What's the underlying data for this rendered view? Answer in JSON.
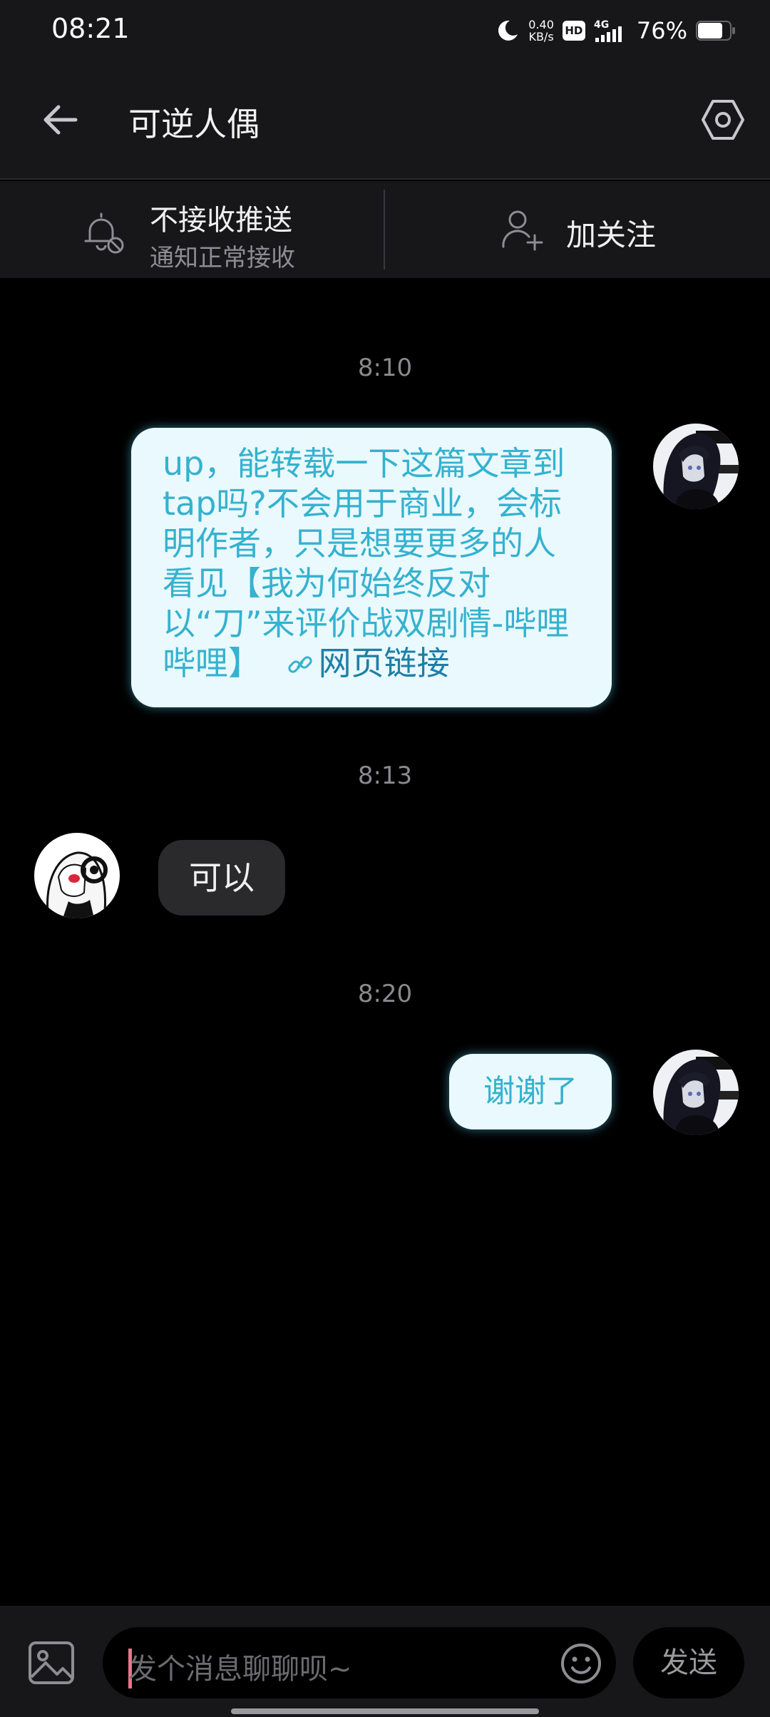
{
  "status_bar": {
    "time": "08:21",
    "net_speed_value": "0.40",
    "net_speed_unit": "KB/s",
    "hd": "HD",
    "network": "4G",
    "battery": "76%"
  },
  "header": {
    "title": "可逆人偶",
    "back_icon": "arrow-left-icon",
    "settings_icon": "hexagon-settings-icon"
  },
  "subscription": {
    "push_title": "不接收推送",
    "push_subtitle": "通知正常接收",
    "follow_label": "加关注"
  },
  "messages": [
    {
      "timestamp": "8:10",
      "direction": "outgoing",
      "text": "up，能转载一下这篇文章到tap吗?不会用于商业，会标明作者，只是想要更多的人看见【我为何始终反对以“刀”来评价战双剧情-哔哩哔哩】",
      "link_label": "网页链接",
      "link_icon": "chain-link-icon"
    },
    {
      "timestamp": "8:13",
      "direction": "incoming",
      "text": "可以"
    },
    {
      "timestamp": "8:20",
      "direction": "outgoing",
      "text": "谢谢了"
    }
  ],
  "input": {
    "placeholder": "发个消息聊聊呗~",
    "send_label": "发送"
  },
  "colors": {
    "outgoing_bubble": "#eaf9fd",
    "outgoing_text": "#35b2cf",
    "incoming_bubble": "#2a2a2c",
    "accent_caret": "#e8758c"
  }
}
